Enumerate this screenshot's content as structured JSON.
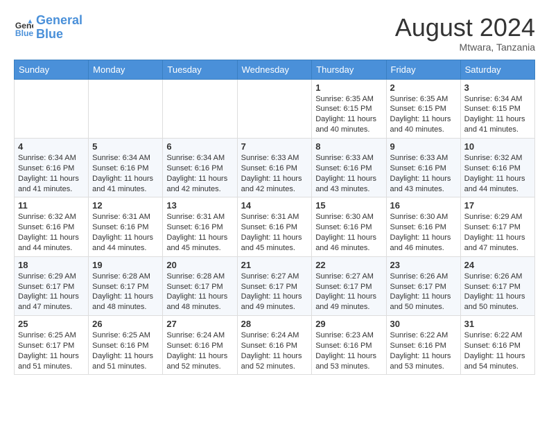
{
  "header": {
    "logo_line1": "General",
    "logo_line2": "Blue",
    "month": "August 2024",
    "location": "Mtwara, Tanzania"
  },
  "days_of_week": [
    "Sunday",
    "Monday",
    "Tuesday",
    "Wednesday",
    "Thursday",
    "Friday",
    "Saturday"
  ],
  "weeks": [
    [
      {
        "day": "",
        "sunrise": "",
        "sunset": "",
        "daylight": ""
      },
      {
        "day": "",
        "sunrise": "",
        "sunset": "",
        "daylight": ""
      },
      {
        "day": "",
        "sunrise": "",
        "sunset": "",
        "daylight": ""
      },
      {
        "day": "",
        "sunrise": "",
        "sunset": "",
        "daylight": ""
      },
      {
        "day": "1",
        "sunrise": "6:35 AM",
        "sunset": "6:15 PM",
        "daylight": "11 hours and 40 minutes."
      },
      {
        "day": "2",
        "sunrise": "6:35 AM",
        "sunset": "6:15 PM",
        "daylight": "11 hours and 40 minutes."
      },
      {
        "day": "3",
        "sunrise": "6:34 AM",
        "sunset": "6:15 PM",
        "daylight": "11 hours and 41 minutes."
      }
    ],
    [
      {
        "day": "4",
        "sunrise": "6:34 AM",
        "sunset": "6:16 PM",
        "daylight": "11 hours and 41 minutes."
      },
      {
        "day": "5",
        "sunrise": "6:34 AM",
        "sunset": "6:16 PM",
        "daylight": "11 hours and 41 minutes."
      },
      {
        "day": "6",
        "sunrise": "6:34 AM",
        "sunset": "6:16 PM",
        "daylight": "11 hours and 42 minutes."
      },
      {
        "day": "7",
        "sunrise": "6:33 AM",
        "sunset": "6:16 PM",
        "daylight": "11 hours and 42 minutes."
      },
      {
        "day": "8",
        "sunrise": "6:33 AM",
        "sunset": "6:16 PM",
        "daylight": "11 hours and 43 minutes."
      },
      {
        "day": "9",
        "sunrise": "6:33 AM",
        "sunset": "6:16 PM",
        "daylight": "11 hours and 43 minutes."
      },
      {
        "day": "10",
        "sunrise": "6:32 AM",
        "sunset": "6:16 PM",
        "daylight": "11 hours and 44 minutes."
      }
    ],
    [
      {
        "day": "11",
        "sunrise": "6:32 AM",
        "sunset": "6:16 PM",
        "daylight": "11 hours and 44 minutes."
      },
      {
        "day": "12",
        "sunrise": "6:31 AM",
        "sunset": "6:16 PM",
        "daylight": "11 hours and 44 minutes."
      },
      {
        "day": "13",
        "sunrise": "6:31 AM",
        "sunset": "6:16 PM",
        "daylight": "11 hours and 45 minutes."
      },
      {
        "day": "14",
        "sunrise": "6:31 AM",
        "sunset": "6:16 PM",
        "daylight": "11 hours and 45 minutes."
      },
      {
        "day": "15",
        "sunrise": "6:30 AM",
        "sunset": "6:16 PM",
        "daylight": "11 hours and 46 minutes."
      },
      {
        "day": "16",
        "sunrise": "6:30 AM",
        "sunset": "6:16 PM",
        "daylight": "11 hours and 46 minutes."
      },
      {
        "day": "17",
        "sunrise": "6:29 AM",
        "sunset": "6:17 PM",
        "daylight": "11 hours and 47 minutes."
      }
    ],
    [
      {
        "day": "18",
        "sunrise": "6:29 AM",
        "sunset": "6:17 PM",
        "daylight": "11 hours and 47 minutes."
      },
      {
        "day": "19",
        "sunrise": "6:28 AM",
        "sunset": "6:17 PM",
        "daylight": "11 hours and 48 minutes."
      },
      {
        "day": "20",
        "sunrise": "6:28 AM",
        "sunset": "6:17 PM",
        "daylight": "11 hours and 48 minutes."
      },
      {
        "day": "21",
        "sunrise": "6:27 AM",
        "sunset": "6:17 PM",
        "daylight": "11 hours and 49 minutes."
      },
      {
        "day": "22",
        "sunrise": "6:27 AM",
        "sunset": "6:17 PM",
        "daylight": "11 hours and 49 minutes."
      },
      {
        "day": "23",
        "sunrise": "6:26 AM",
        "sunset": "6:17 PM",
        "daylight": "11 hours and 50 minutes."
      },
      {
        "day": "24",
        "sunrise": "6:26 AM",
        "sunset": "6:17 PM",
        "daylight": "11 hours and 50 minutes."
      }
    ],
    [
      {
        "day": "25",
        "sunrise": "6:25 AM",
        "sunset": "6:17 PM",
        "daylight": "11 hours and 51 minutes."
      },
      {
        "day": "26",
        "sunrise": "6:25 AM",
        "sunset": "6:16 PM",
        "daylight": "11 hours and 51 minutes."
      },
      {
        "day": "27",
        "sunrise": "6:24 AM",
        "sunset": "6:16 PM",
        "daylight": "11 hours and 52 minutes."
      },
      {
        "day": "28",
        "sunrise": "6:24 AM",
        "sunset": "6:16 PM",
        "daylight": "11 hours and 52 minutes."
      },
      {
        "day": "29",
        "sunrise": "6:23 AM",
        "sunset": "6:16 PM",
        "daylight": "11 hours and 53 minutes."
      },
      {
        "day": "30",
        "sunrise": "6:22 AM",
        "sunset": "6:16 PM",
        "daylight": "11 hours and 53 minutes."
      },
      {
        "day": "31",
        "sunrise": "6:22 AM",
        "sunset": "6:16 PM",
        "daylight": "11 hours and 54 minutes."
      }
    ]
  ]
}
